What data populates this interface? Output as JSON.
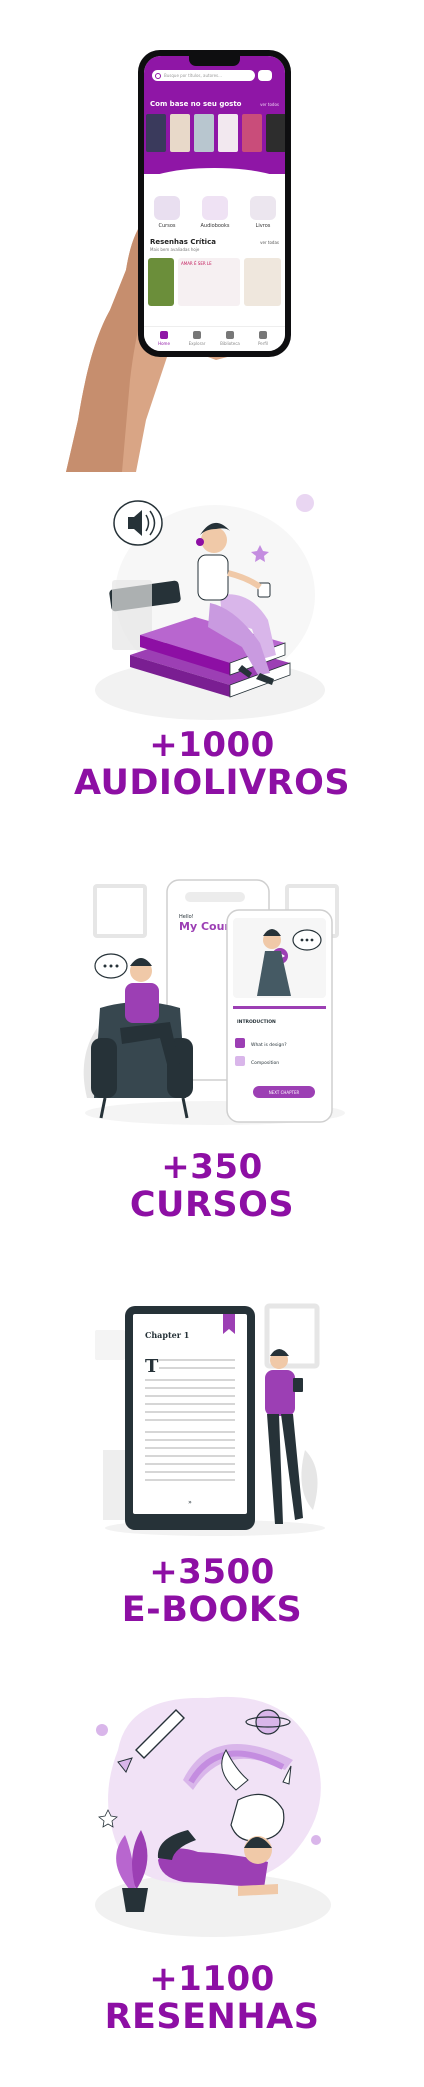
{
  "colors": {
    "brand": "#8d0fa4",
    "brand_light": "#c48de0",
    "dark": "#263238"
  },
  "phone": {
    "search_placeholder": "Busque por títulos, autores...",
    "section_title": "Com base no seu gosto",
    "section_more": "ver todos",
    "categories": [
      "Cursos",
      "Audiobooks",
      "Livros"
    ],
    "reviews_title": "Resenhas Crítica",
    "reviews_subtitle": "Mais bem avaliadas hoje",
    "reviews_more": "ver todas",
    "review_card_text": "AMAR É SER LE",
    "tabs": [
      {
        "label": "Home",
        "icon": "home-icon"
      },
      {
        "label": "Explorar",
        "icon": "search-icon"
      },
      {
        "label": "Biblioteca",
        "icon": "library-icon"
      },
      {
        "label": "Perfil",
        "icon": "user-icon"
      }
    ]
  },
  "stats": [
    {
      "number": "+1000",
      "label": "AUDIOLIVROS",
      "illustration": "audiobook-listener-illustration"
    },
    {
      "number": "+350",
      "label": "CURSOS",
      "illustration": "online-courses-illustration"
    },
    {
      "number": "+3500",
      "label": "E-BOOKS",
      "illustration": "ebook-reader-illustration"
    },
    {
      "number": "+1100",
      "label": "RESENHAS",
      "illustration": "reviews-dreaming-illustration"
    }
  ],
  "illus_text": {
    "courses_header": "Hello!",
    "courses_title": "My Courses",
    "courses_intro": "INTRODUCTION",
    "lesson_1": "What is design?",
    "lesson_2": "Composition",
    "next_button": "NEXT CHAPTER",
    "ebook_chapter": "Chapter 1",
    "ebook_dropcap": "T"
  }
}
